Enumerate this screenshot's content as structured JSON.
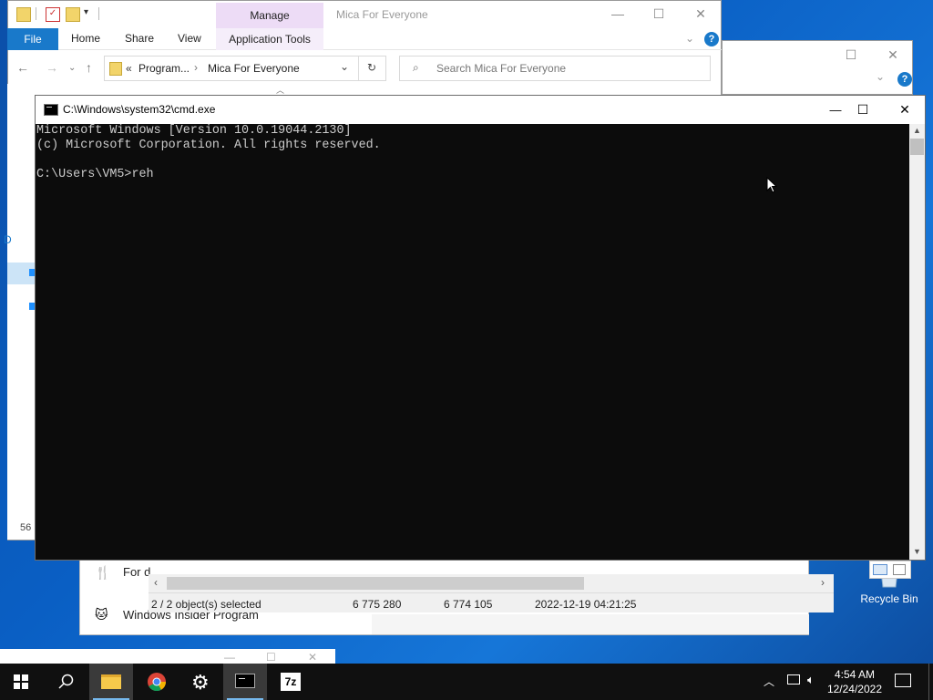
{
  "desktop": {
    "icons": [
      {
        "label": "Recycle Bin"
      }
    ]
  },
  "explorer": {
    "context_tab": "Manage",
    "title": "Mica For Everyone",
    "ribbon_tabs": [
      "File",
      "Home",
      "Share",
      "View"
    ],
    "context_subtab": "Application Tools",
    "address": {
      "prefix": "«",
      "crumb1": "Program...",
      "crumb2": "Mica For Everyone"
    },
    "search_placeholder": "Search Mica For Everyone",
    "item_count_partial": "56",
    "left_letter": "D"
  },
  "explorer_back": {
    "rows": [
      {
        "label": "For d",
        "icon": "fork-knife-icon"
      },
      {
        "label": "Windows Insider Program",
        "icon": "cat-icon"
      }
    ]
  },
  "statusbar": {
    "selected": "2 / 2 object(s) selected",
    "size1": "6 775 280",
    "size2": "6 774 105",
    "date": "2022-12-19 04:21:25"
  },
  "cmd": {
    "title": "C:\\Windows\\system32\\cmd.exe",
    "lines": [
      "Microsoft Windows [Version 10.0.19044.2130]",
      "(c) Microsoft Corporation. All rights reserved.",
      "",
      "C:\\Users\\VM5>reh"
    ]
  },
  "taskbar": {
    "apps": [
      "start",
      "search",
      "file-explorer",
      "chrome",
      "settings",
      "cmd",
      "7zip"
    ],
    "seven_zip_label": "7z",
    "time": "4:54 AM",
    "date": "12/24/2022"
  },
  "colors": {
    "accent": "#1979ca",
    "manage": "#eddcf6",
    "taskbar": "#101010",
    "console_bg": "#0c0c0c",
    "console_fg": "#cccccc"
  }
}
